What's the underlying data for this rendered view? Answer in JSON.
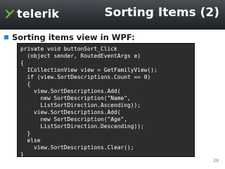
{
  "logo": {
    "text": "telerik"
  },
  "title": "Sorting Items (2)",
  "bullet": {
    "text": "Sorting items view in WPF:"
  },
  "code": {
    "lines": [
      "private void buttonSort_Click",
      "  (object sender, RoutedEventArgs e)",
      "{",
      "  ICollectionView view = GetFamilyView();",
      "  if (view.SortDescriptions.Count == 0)",
      "  {",
      "    view.SortDescriptions.Add(",
      "      new SortDescription(\"Name\",",
      "      ListSortDirection.Ascending));",
      "    view.SortDescriptions.Add(",
      "      new SortDescription(\"Age\",",
      "      ListSortDirection.Descending));",
      "  }",
      "  else",
      "    view.SortDescriptions.Clear();",
      "}"
    ]
  },
  "page_number": "29",
  "colors": {
    "header_dark": "#1f2226",
    "header_light": "#4b4f55",
    "logo_green": "#6cba2c",
    "bullet_blue": "#2f86c7",
    "code_bg": "#2d2d2d",
    "code_text": "#ffffff"
  }
}
